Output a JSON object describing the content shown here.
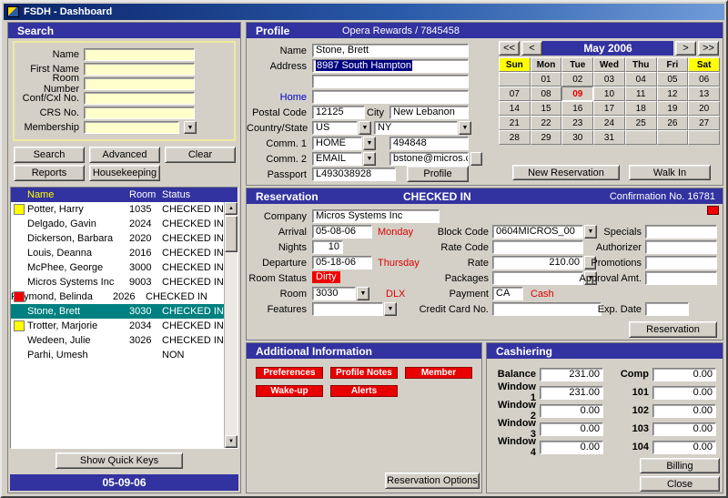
{
  "window": {
    "title": "FSDH - Dashboard"
  },
  "icons": {
    "dropdown": "▼",
    "scroll_up": "▲",
    "scroll_down": "▼"
  },
  "colors": {
    "header": "#3232a0",
    "selection": "#008080",
    "alert_red": "#e80000",
    "field_cream": "#ffffcc",
    "weekend_yellow": "#ffff00"
  },
  "search": {
    "header": "Search",
    "fields": [
      {
        "label": "Name"
      },
      {
        "label": "First Name"
      },
      {
        "label": "Room Number"
      },
      {
        "label": "Conf/Cxl No."
      },
      {
        "label": "CRS No."
      },
      {
        "label": "Membership",
        "dropdown": true
      }
    ],
    "buttons": {
      "search": "Search",
      "advanced": "Advanced",
      "clear": "Clear",
      "reports": "Reports",
      "housekeeping": "Housekeeping"
    },
    "list": {
      "columns": [
        "Name",
        "Room",
        "Status"
      ],
      "rows": [
        {
          "name": "Potter, Harry",
          "room": "1035",
          "status": "CHECKED IN",
          "marker": "yellow",
          "selected": false
        },
        {
          "name": "Delgado, Gavin",
          "room": "2024",
          "status": "CHECKED IN",
          "marker": "",
          "selected": false
        },
        {
          "name": "Dickerson, Barbara",
          "room": "2020",
          "status": "CHECKED IN",
          "marker": "",
          "selected": false
        },
        {
          "name": "Louis, Deanna",
          "room": "2016",
          "status": "CHECKED IN",
          "marker": "",
          "selected": false
        },
        {
          "name": "McPhee, George",
          "room": "3000",
          "status": "CHECKED IN",
          "marker": "",
          "selected": false
        },
        {
          "name": "Micros Systems Inc",
          "room": "9003",
          "status": "CHECKED IN",
          "marker": "",
          "selected": false
        },
        {
          "name": "Raymond, Belinda",
          "room": "2026",
          "status": "CHECKED IN",
          "marker": "red",
          "selected": false
        },
        {
          "name": "Stone, Brett",
          "room": "3030",
          "status": "CHECKED IN",
          "marker": "",
          "selected": true
        },
        {
          "name": "Trotter, Marjorie",
          "room": "2034",
          "status": "CHECKED IN",
          "marker": "yellow",
          "selected": false
        },
        {
          "name": "Wedeen, Julie",
          "room": "3026",
          "status": "CHECKED IN",
          "marker": "",
          "selected": false
        },
        {
          "name": "Parhi, Umesh",
          "room": "",
          "status": "NON",
          "marker": "",
          "selected": false
        }
      ]
    },
    "quick_keys": "Show Quick Keys",
    "date": "05-09-06"
  },
  "profile": {
    "header": "Profile",
    "subtitle": "Opera Rewards / 7845458",
    "name_label": "Name",
    "name": "Stone, Brett",
    "address_label": "Address",
    "address1": "8987 South Hampton",
    "address2": "",
    "address3": "",
    "home_label": "Home",
    "postal_label": "Postal Code",
    "postal": "12125",
    "city_label": "City",
    "city": "New Lebanon",
    "country_label": "Country/State",
    "country": "US",
    "state": "NY",
    "comm1_label": "Comm. 1",
    "comm1_type": "HOME",
    "comm1_value": "494848",
    "comm2_label": "Comm. 2",
    "comm2_type": "EMAIL",
    "comm2_value": "bstone@micros.c",
    "passport_label": "Passport",
    "passport": "L493038928",
    "profile_button": "Profile"
  },
  "calendar": {
    "nav": [
      "<<",
      "<",
      ">",
      ">>"
    ],
    "month": "May 2006",
    "day_headers": [
      "Sun",
      "Mon",
      "Tue",
      "Wed",
      "Thu",
      "Fri",
      "Sat"
    ],
    "weeks": [
      [
        "",
        "01",
        "02",
        "03",
        "04",
        "05",
        "06"
      ],
      [
        "07",
        "08",
        "09",
        "10",
        "11",
        "12",
        "13"
      ],
      [
        "14",
        "15",
        "16",
        "17",
        "18",
        "19",
        "20"
      ],
      [
        "21",
        "22",
        "23",
        "24",
        "25",
        "26",
        "27"
      ],
      [
        "28",
        "29",
        "30",
        "31",
        "",
        "",
        ""
      ]
    ],
    "today": "09",
    "buttons": {
      "new_reservation": "New Reservation",
      "walk_in": "Walk In"
    }
  },
  "reservation": {
    "header": "Reservation",
    "status": "CHECKED IN",
    "confirmation": "Confirmation No. 16781",
    "company_label": "Company",
    "company": "Micros Systems Inc",
    "arrival_label": "Arrival",
    "arrival": "05-08-06",
    "arrival_day": "Monday",
    "nights_label": "Nights",
    "nights": "10",
    "departure_label": "Departure",
    "departure": "05-18-06",
    "departure_day": "Thursday",
    "room_status_label": "Room Status",
    "room_status": "Dirty",
    "room_label": "Room",
    "room": "3030",
    "room_type": "DLX",
    "features_label": "Features",
    "features": "",
    "block_label": "Block Code",
    "block": "0604MICROS_00",
    "rate_code_label": "Rate Code",
    "rate_code": "",
    "rate_label": "Rate",
    "rate": "210.00",
    "packages_label": "Packages",
    "packages": "",
    "payment_label": "Payment",
    "payment": "CA",
    "payment_type": "Cash",
    "cc_label": "Credit Card No.",
    "cc": "",
    "specials_label": "Specials",
    "specials": "",
    "authorizer_label": "Authorizer",
    "authorizer": "",
    "promotions_label": "Promotions",
    "promotions": "",
    "approval_label": "Approval Amt.",
    "approval": "",
    "exp_label": "Exp. Date",
    "exp_date": "",
    "reservation_button": "Reservation"
  },
  "additional": {
    "header": "Additional Information",
    "buttons": [
      "Preferences",
      "Profile Notes",
      "Member",
      "Wake-up",
      "Alerts"
    ],
    "reservation_options": "Reservation Options"
  },
  "cashiering": {
    "header": "Cashiering",
    "rows": [
      {
        "left_label": "Balance",
        "left_value": "231.00",
        "right_label": "Comp",
        "right_value": "0.00"
      },
      {
        "left_label": "Window 1",
        "left_value": "231.00",
        "right_label": "101",
        "right_value": "0.00"
      },
      {
        "left_label": "Window 2",
        "left_value": "0.00",
        "right_label": "102",
        "right_value": "0.00"
      },
      {
        "left_label": "Window 3",
        "left_value": "0.00",
        "right_label": "103",
        "right_value": "0.00"
      },
      {
        "left_label": "Window 4",
        "left_value": "0.00",
        "right_label": "104",
        "right_value": "0.00"
      }
    ],
    "billing": "Billing",
    "close": "Close"
  }
}
